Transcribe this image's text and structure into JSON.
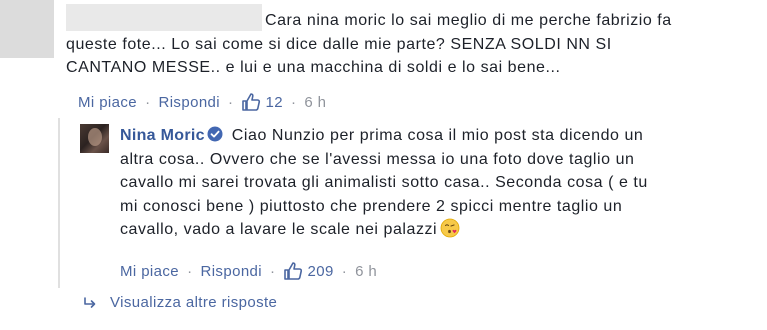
{
  "comment": {
    "text_lines": [
      "Cara nina moric lo sai meglio di me perche fabrizio fa",
      "queste fote... Lo sai come si dice dalle mie parte? SENZA SOLDI NN SI",
      "CANTANO MESSE.. e lui e una macchina di soldi e lo sai bene..."
    ],
    "like_label": "Mi piace",
    "reply_label": "Rispondi",
    "like_count": "12",
    "time": "6 h"
  },
  "reply": {
    "author": "Nina Moric",
    "text_lines": [
      "Ciao Nunzio per prima cosa il mio post sta dicendo un",
      "altra cosa.. Ovvero che se l'avessi messa io una foto dove taglio un",
      "cavallo mi sarei trovata gli animalisti sotto casa.. Seconda cosa ( e tu",
      "mi conosci bene ) piuttosto che prendere 2 spicci mentre taglio un",
      "cavallo, vado a lavare le scale nei palazzi"
    ],
    "like_label": "Mi piace",
    "reply_label": "Rispondi",
    "like_count": "209",
    "time": "6 h"
  },
  "more_replies": {
    "label": "Visualizza altre risposte"
  },
  "icons": {
    "like": "thumbs-up-icon",
    "verified": "verified-badge-icon",
    "emoji": "kissing-heart-emoji-icon",
    "more": "reply-arrow-icon"
  },
  "colors": {
    "link": "#4b67a1",
    "author": "#365899",
    "meta": "#90949c",
    "verified": "#4267b2"
  }
}
